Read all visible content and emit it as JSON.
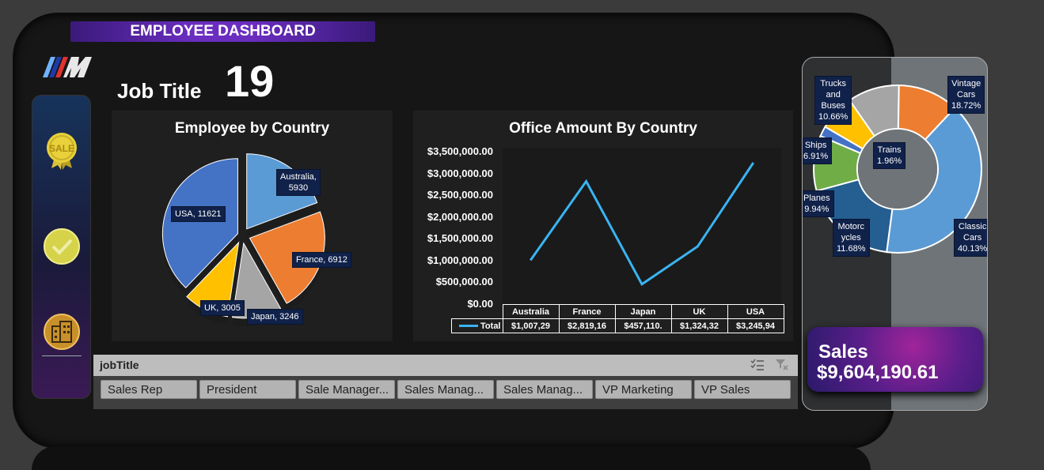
{
  "header": {
    "title": "EMPLOYEE DASHBOARD"
  },
  "kpi": {
    "label": "Job Title",
    "value": "19"
  },
  "sidebar": {
    "icons": [
      "sale-badge-icon",
      "checkmark-icon",
      "buildings-icon"
    ]
  },
  "colors": {
    "accent_purple": "#6a2dbf",
    "line_blue": "#3ab4f2",
    "label_bg": "#10214a"
  },
  "chart_data": [
    {
      "type": "pie",
      "title": "Employee by Country",
      "categories": [
        "Australia",
        "France",
        "Japan",
        "UK",
        "USA"
      ],
      "values": [
        5930,
        6912,
        3246,
        3005,
        11621
      ],
      "labels": [
        "Australia,\n5930",
        "France, 6912",
        "Japan, 3246",
        "UK, 3005",
        "USA, 11621"
      ],
      "colors": [
        "#5b9bd5",
        "#ed7d31",
        "#a5a5a5",
        "#ffc000",
        "#4472c4"
      ]
    },
    {
      "type": "line",
      "title": "Office Amount By Country",
      "categories": [
        "Australia",
        "France",
        "Japan",
        "UK",
        "USA"
      ],
      "series": [
        {
          "name": "Total",
          "values": [
            1007290,
            2819160,
            457110,
            1324320,
            3245940
          ]
        }
      ],
      "ylim": [
        0,
        3500000
      ],
      "yticks": [
        "$3,500,000.00",
        "$3,000,000.00",
        "$2,500,000.00",
        "$2,000,000.00",
        "$1,500,000.00",
        "$1,000,000.00",
        "$500,000.00",
        "$0.00"
      ],
      "table_header": [
        "Australia",
        "France",
        "Japan",
        "UK",
        "USA"
      ],
      "table_row_label": "Total",
      "table_values": [
        "$1,007,29",
        "$2,819,16",
        "$457,110.",
        "$1,324,32",
        "$3,245,94"
      ]
    },
    {
      "type": "pie",
      "subtype": "donut",
      "categories": [
        "Classic Cars",
        "Vintage Cars",
        "Trucks and Buses",
        "Trains",
        "Ships",
        "Planes",
        "Motorcycles"
      ],
      "values": [
        40.13,
        18.72,
        10.66,
        1.96,
        6.91,
        9.94,
        11.68
      ],
      "labels": [
        "Classic\nCars\n40.13%",
        "Vintage\nCars\n18.72%",
        "Trucks\nand\nBuses\n10.66%",
        "Trains\n1.96%",
        "Ships\n6.91%",
        "Planes\n9.94%",
        "Motorc\nycles\n11.68%"
      ],
      "colors": [
        "#5b9bd5",
        "#255e91",
        "#70ad47",
        "#4472c4",
        "#ffc000",
        "#a5a5a5",
        "#ed7d31"
      ]
    }
  ],
  "slicer": {
    "title": "jobTitle",
    "items": [
      "Sales Rep",
      "President",
      "Sale Manager...",
      "Sales Manag...",
      "Sales Manag...",
      "VP Marketing",
      "VP Sales"
    ]
  },
  "sales": {
    "label": "Sales",
    "value": "$9,604,190.61"
  }
}
